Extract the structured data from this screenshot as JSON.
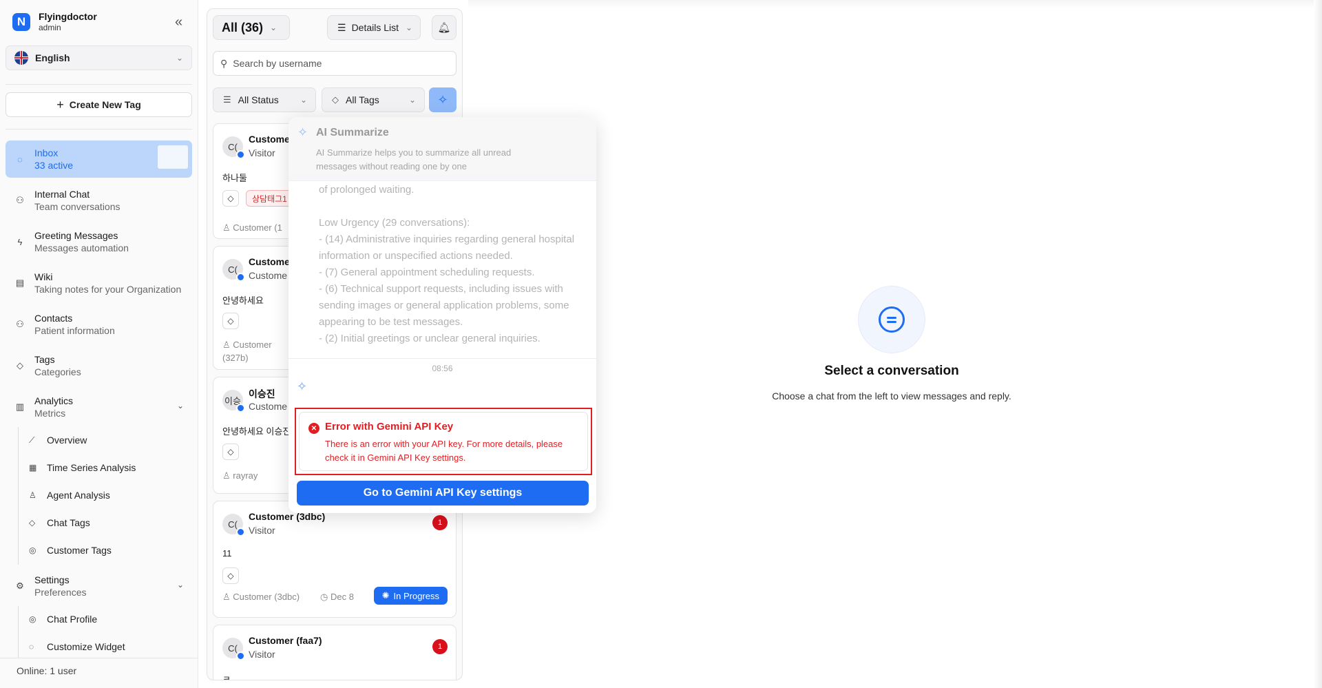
{
  "brand": {
    "name": "Flyingdoctor",
    "role": "admin",
    "logo": "N"
  },
  "language": {
    "selected": "English"
  },
  "create_tag_label": "Create New Tag",
  "nav": [
    {
      "title": "Inbox",
      "sub": "33 active",
      "icon": "chat-icon"
    },
    {
      "title": "Internal Chat",
      "sub": "Team conversations",
      "icon": "team-icon"
    },
    {
      "title": "Greeting Messages",
      "sub": "Messages automation",
      "icon": "bolt-icon"
    },
    {
      "title": "Wiki",
      "sub": "Taking notes for your Organization",
      "icon": "book-icon"
    },
    {
      "title": "Contacts",
      "sub": "Patient information",
      "icon": "contacts-icon"
    },
    {
      "title": "Tags",
      "sub": "Categories",
      "icon": "tag-icon"
    },
    {
      "title": "Analytics",
      "sub": "Metrics",
      "icon": "chart-icon"
    },
    {
      "title": "Settings",
      "sub": "Preferences",
      "icon": "gear-icon"
    }
  ],
  "analytics_items": [
    {
      "label": "Overview",
      "icon": "line-chart-icon"
    },
    {
      "label": "Time Series Analysis",
      "icon": "calendar-icon"
    },
    {
      "label": "Agent Analysis",
      "icon": "agent-icon"
    },
    {
      "label": "Chat Tags",
      "icon": "tag-icon"
    },
    {
      "label": "Customer Tags",
      "icon": "customer-tag-icon"
    }
  ],
  "settings_items": [
    {
      "label": "Chat Profile",
      "icon": "profile-icon"
    },
    {
      "label": "Customize Widget",
      "icon": "widget-icon"
    }
  ],
  "online_status": "Online:  1 user",
  "list": {
    "all_label": "All (36)",
    "view_label": "Details List",
    "search_placeholder": "Search by username",
    "status_filter": "All Status",
    "tags_filter": "All Tags"
  },
  "cards": [
    {
      "avatar": "C(",
      "name": "Custome",
      "role": "Visitor",
      "message": "하나둘",
      "tag": "상담태그1",
      "agent": "Customer (1"
    },
    {
      "avatar": "C(",
      "name": "Custome",
      "role": "Custome",
      "message": "안녕하세요",
      "agent": "Customer\n(327b)"
    },
    {
      "avatar": "이승",
      "name": "이승진",
      "role": "Custome",
      "message": "안녕하세요 이승진",
      "agent": "rayray"
    },
    {
      "avatar": "C(",
      "name": "Customer (3dbc)",
      "role": "Visitor",
      "message": "11",
      "agent": "Customer (3dbc)",
      "date": "Dec 8",
      "status": "In Progress",
      "unread": "1"
    },
    {
      "avatar": "C(",
      "name": "Customer (faa7)",
      "role": "Visitor",
      "message": "ㅋ",
      "unread": "1"
    }
  ],
  "ai_popover": {
    "title": "AI Summarize",
    "description": "AI Summarize helps you to summarize all unread messages without reading one by one",
    "summary": "of prolonged waiting.\n\nLow Urgency (29 conversations):\n- (14) Administrative inquiries regarding general hospital information or unspecified actions needed.\n- (7) General appointment scheduling requests.\n- (6) Technical support requests, including issues with sending images or general application problems, some appearing to be test messages.\n- (2) Initial greetings or unclear general inquiries.",
    "time": "08:56",
    "error_title": "Error with Gemini API Key",
    "error_message": "There is an error with your API key. For more details, please check it in Gemini API Key settings.",
    "button_label": "Go to Gemini API Key settings"
  },
  "empty_state": {
    "title": "Select a conversation",
    "subtitle": "Choose a chat from the left to view messages and reply."
  },
  "colors": {
    "accent": "#1d6cf2",
    "error": "#e11d22",
    "active_nav": "#bcd6fb",
    "unread": "#d90f1c"
  }
}
